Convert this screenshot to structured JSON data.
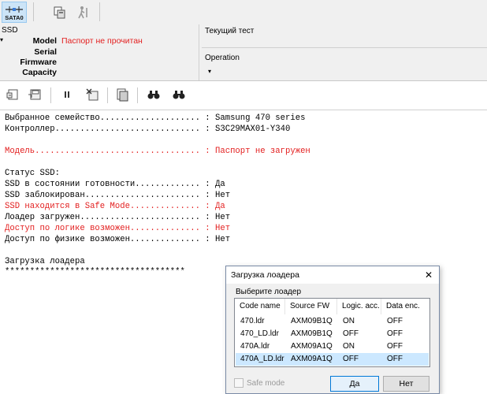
{
  "toolbar": {
    "sata_label": "SATA0",
    "buttons": [
      "sata0",
      "copy",
      "walk"
    ]
  },
  "info_panel": {
    "section_label": "SSD",
    "fields": [
      {
        "name": "Model",
        "value": "Паспорт не прочитан"
      },
      {
        "name": "Serial",
        "value": ""
      },
      {
        "name": "Firmware",
        "value": ""
      },
      {
        "name": "Capacity",
        "value": ""
      }
    ],
    "current_test_label": "Текущий тест",
    "operation_label": "Operation"
  },
  "colors": {
    "error_text": "#e32020",
    "selection": "#cce8ff",
    "accent_border": "#0078d7"
  },
  "log": [
    {
      "text": "Выбранное семейство.................... : Samsung 470 series",
      "style": "normal"
    },
    {
      "text": "Контроллер............................. : S3C29MAX01-Y340",
      "style": "normal"
    },
    {
      "text": "",
      "style": "normal"
    },
    {
      "text": "Модель................................. : Паспорт не загружен",
      "style": "red"
    },
    {
      "text": "",
      "style": "normal"
    },
    {
      "text": "Статус SSD:",
      "style": "normal"
    },
    {
      "text": "SSD в состоянии готовности............. : Да",
      "style": "normal"
    },
    {
      "text": "SSD заблокирован....................... : Нет",
      "style": "normal"
    },
    {
      "text": "SSD находится в Safe Mode.............. : Да",
      "style": "red"
    },
    {
      "text": "Лоадер загружен........................ : Нет",
      "style": "normal"
    },
    {
      "text": "Доступ по логике возможен.............. : Нет",
      "style": "red"
    },
    {
      "text": "Доступ по физике возможен.............. : Нет",
      "style": "normal"
    },
    {
      "text": "",
      "style": "normal"
    },
    {
      "text": "Загрузка лоадера",
      "style": "normal"
    },
    {
      "text": "************************************",
      "style": "normal"
    }
  ],
  "dialog": {
    "title": "Загрузка лоадера",
    "prompt": "Выберите лоадер",
    "columns": [
      "Code name",
      "Source FW",
      "Logic. acc.",
      "Data enc."
    ],
    "rows": [
      [
        "470.ldr",
        "AXM09B1Q",
        "ON",
        "OFF"
      ],
      [
        "470_LD.ldr",
        "AXM09B1Q",
        "OFF",
        "OFF"
      ],
      [
        "470A.ldr",
        "AXM09A1Q",
        "ON",
        "OFF"
      ],
      [
        "470A_LD.ldr",
        "AXM09A1Q",
        "OFF",
        "OFF"
      ]
    ],
    "selected_row": 3,
    "safe_mode_label": "Safe mode",
    "safe_mode_checked": false,
    "yes_label": "Да",
    "no_label": "Нет",
    "close_glyph": "✕"
  }
}
